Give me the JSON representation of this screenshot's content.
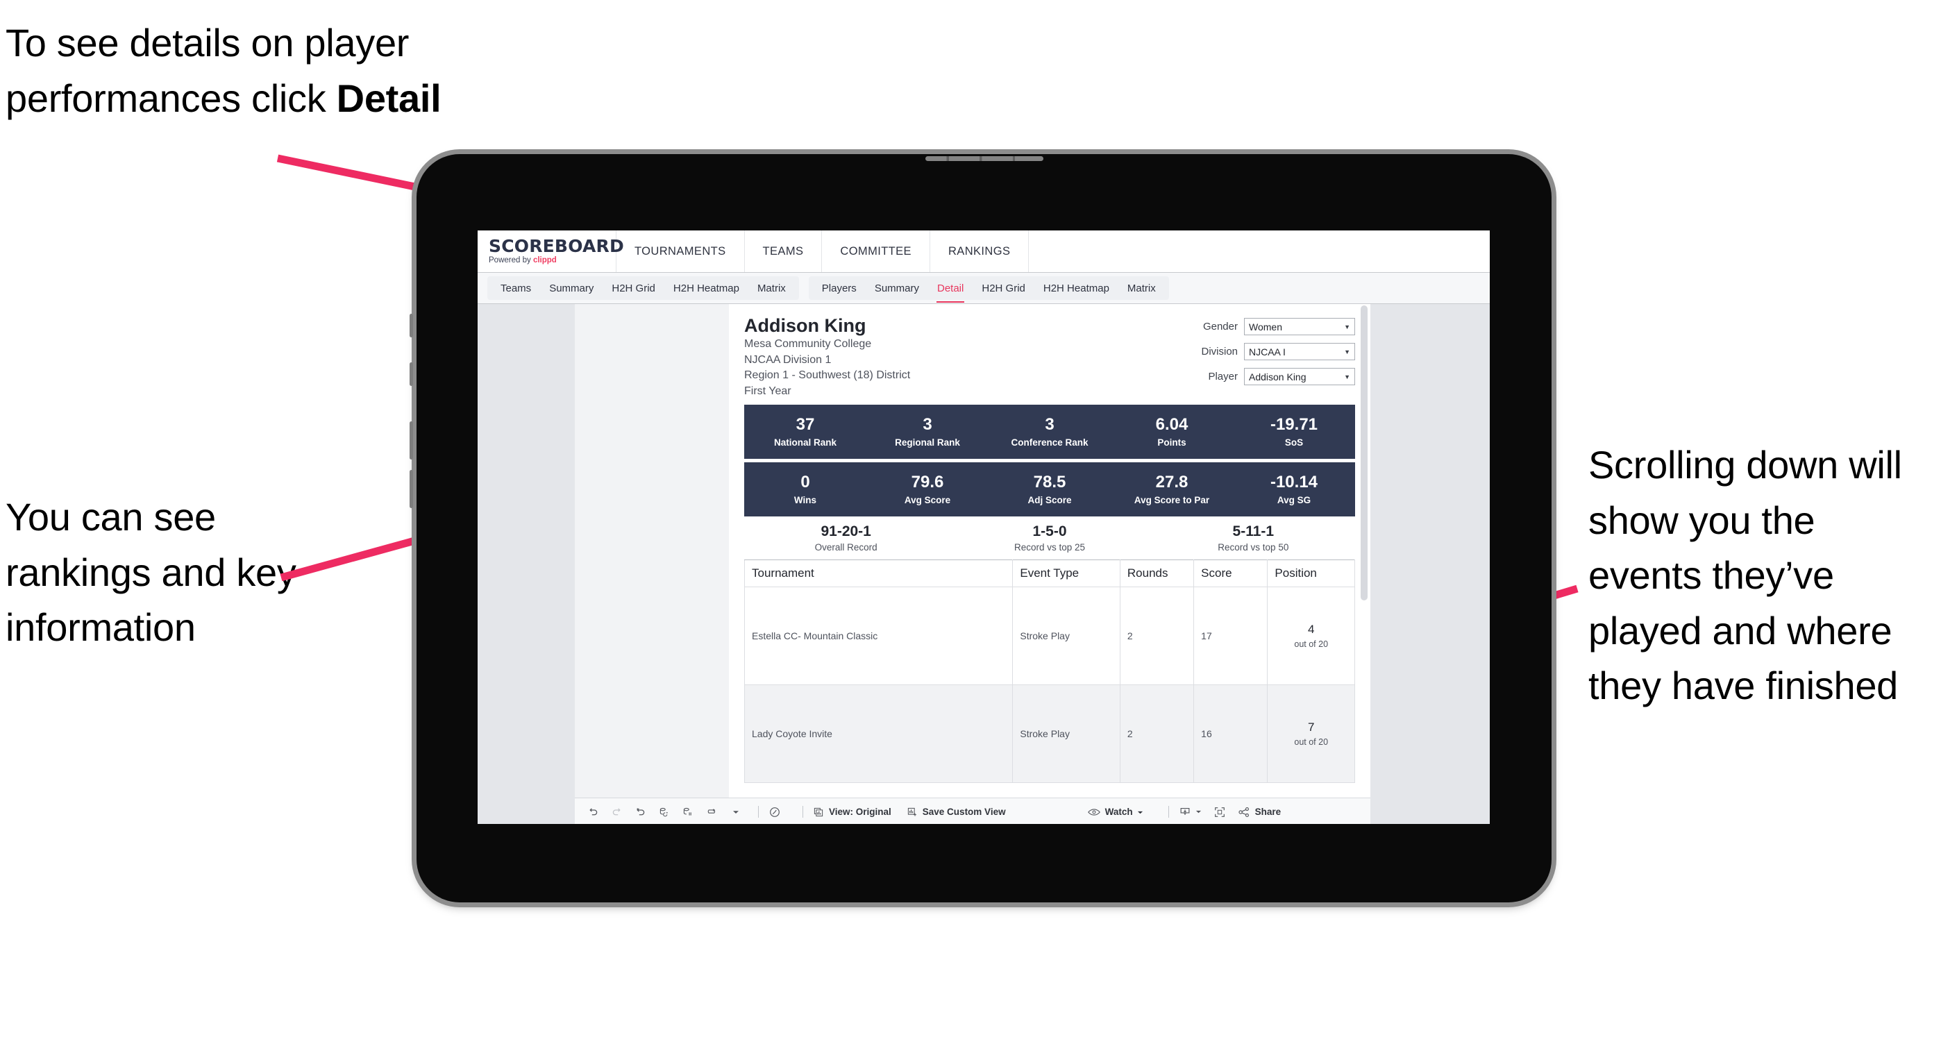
{
  "annotations": {
    "top_left": "To see details on player performances click ",
    "top_left_bold": "Detail",
    "mid_left": "You can see rankings and key information",
    "right": "Scrolling down will show you the events they’ve played and where they have finished"
  },
  "colors": {
    "accent_pink": "#e8365d",
    "arrow_pink": "#ee2b62",
    "navy": "#313a53",
    "brand_dark": "#2b3248"
  },
  "app": {
    "logo": {
      "word": "SCOREBOARD",
      "powered_by": "Powered by ",
      "brand": "clippd"
    },
    "top_nav": [
      "TOURNAMENTS",
      "TEAMS",
      "COMMITTEE",
      "RANKINGS"
    ],
    "tabs_left": [
      "Teams",
      "Summary",
      "H2H Grid",
      "H2H Heatmap",
      "Matrix"
    ],
    "tabs_right": [
      "Players",
      "Summary",
      "Detail",
      "H2H Grid",
      "H2H Heatmap",
      "Matrix"
    ],
    "active_tab": "Detail"
  },
  "player": {
    "name": "Addison King",
    "school": "Mesa Community College",
    "division": "NJCAA Division 1",
    "region": "Region 1 - Southwest (18) District",
    "year": "First Year"
  },
  "filters": [
    {
      "label": "Gender",
      "value": "Women"
    },
    {
      "label": "Division",
      "value": "NJCAA I"
    },
    {
      "label": "Player",
      "value": "Addison King"
    }
  ],
  "stats_row_1": [
    {
      "value": "37",
      "label": "National Rank"
    },
    {
      "value": "3",
      "label": "Regional Rank"
    },
    {
      "value": "3",
      "label": "Conference Rank"
    },
    {
      "value": "6.04",
      "label": "Points"
    },
    {
      "value": "-19.71",
      "label": "SoS"
    }
  ],
  "stats_row_2": [
    {
      "value": "0",
      "label": "Wins"
    },
    {
      "value": "79.6",
      "label": "Avg Score"
    },
    {
      "value": "78.5",
      "label": "Adj Score"
    },
    {
      "value": "27.8",
      "label": "Avg Score to Par"
    },
    {
      "value": "-10.14",
      "label": "Avg SG"
    }
  ],
  "records": [
    {
      "value": "91-20-1",
      "label": "Overall Record"
    },
    {
      "value": "1-5-0",
      "label": "Record vs top 25"
    },
    {
      "value": "5-11-1",
      "label": "Record vs top 50"
    }
  ],
  "table": {
    "headers": [
      "Tournament",
      "Event Type",
      "Rounds",
      "Score",
      "Position"
    ],
    "rows": [
      {
        "tournament": "Estella CC- Mountain Classic",
        "event_type": "Stroke Play",
        "rounds": "2",
        "score": "17",
        "position_rank": "4",
        "position_of": "out of 20"
      },
      {
        "tournament": "Lady Coyote Invite",
        "event_type": "Stroke Play",
        "rounds": "2",
        "score": "16",
        "position_rank": "7",
        "position_of": "out of 20"
      }
    ]
  },
  "toolbar": {
    "view_label": "View: Original",
    "save_label": "Save Custom View",
    "watch_label": "Watch",
    "share_label": "Share"
  }
}
